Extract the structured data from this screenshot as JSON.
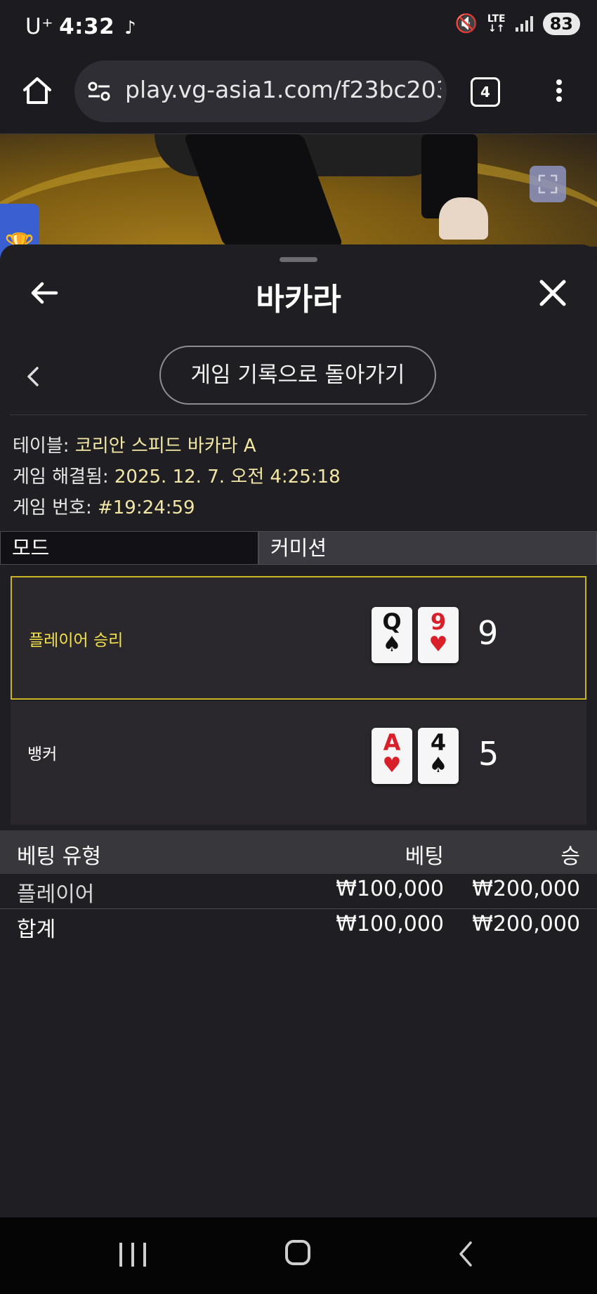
{
  "status_bar": {
    "carrier": "U⁺",
    "time": "4:32",
    "network": "LTE",
    "battery": "83"
  },
  "browser": {
    "url": "play.vg-asia1.com/f23bc203",
    "tab_count": "4"
  },
  "sheet": {
    "title": "바카라",
    "history_button": "게임 기록으로 돌아가기"
  },
  "game_info": {
    "table_label": "테이블:",
    "table_value": "코리안 스피드 바카라 A",
    "resolved_label": "게임 해결됨:",
    "resolved_value": "2025. 12. 7. 오전 4:25:18",
    "number_label": "게임 번호:",
    "number_value": "#19:24:59"
  },
  "mode": {
    "mode_label": "모드",
    "commission_label": "커미션"
  },
  "hands": {
    "player": {
      "label": "플레이어 승리",
      "cards": [
        {
          "rank": "Q",
          "suit": "♠",
          "color": "black"
        },
        {
          "rank": "9",
          "suit": "♥",
          "color": "red"
        }
      ],
      "score": "9"
    },
    "banker": {
      "label": "뱅커",
      "cards": [
        {
          "rank": "A",
          "suit": "♥",
          "color": "red"
        },
        {
          "rank": "4",
          "suit": "♠",
          "color": "black"
        }
      ],
      "score": "5"
    }
  },
  "bets": {
    "headers": {
      "type": "베팅 유형",
      "bet": "베팅",
      "win": "승"
    },
    "rows": [
      {
        "type": "플레이어",
        "bet": "₩100,000",
        "win": "₩200,000"
      }
    ],
    "total": {
      "type": "합계",
      "bet": "₩100,000",
      "win": "₩200,000"
    }
  },
  "colors": {
    "win_border": "#c8b420",
    "win_text": "#f4e14a",
    "info_value": "#f3e7a5",
    "red_suit": "#d91f2a"
  }
}
